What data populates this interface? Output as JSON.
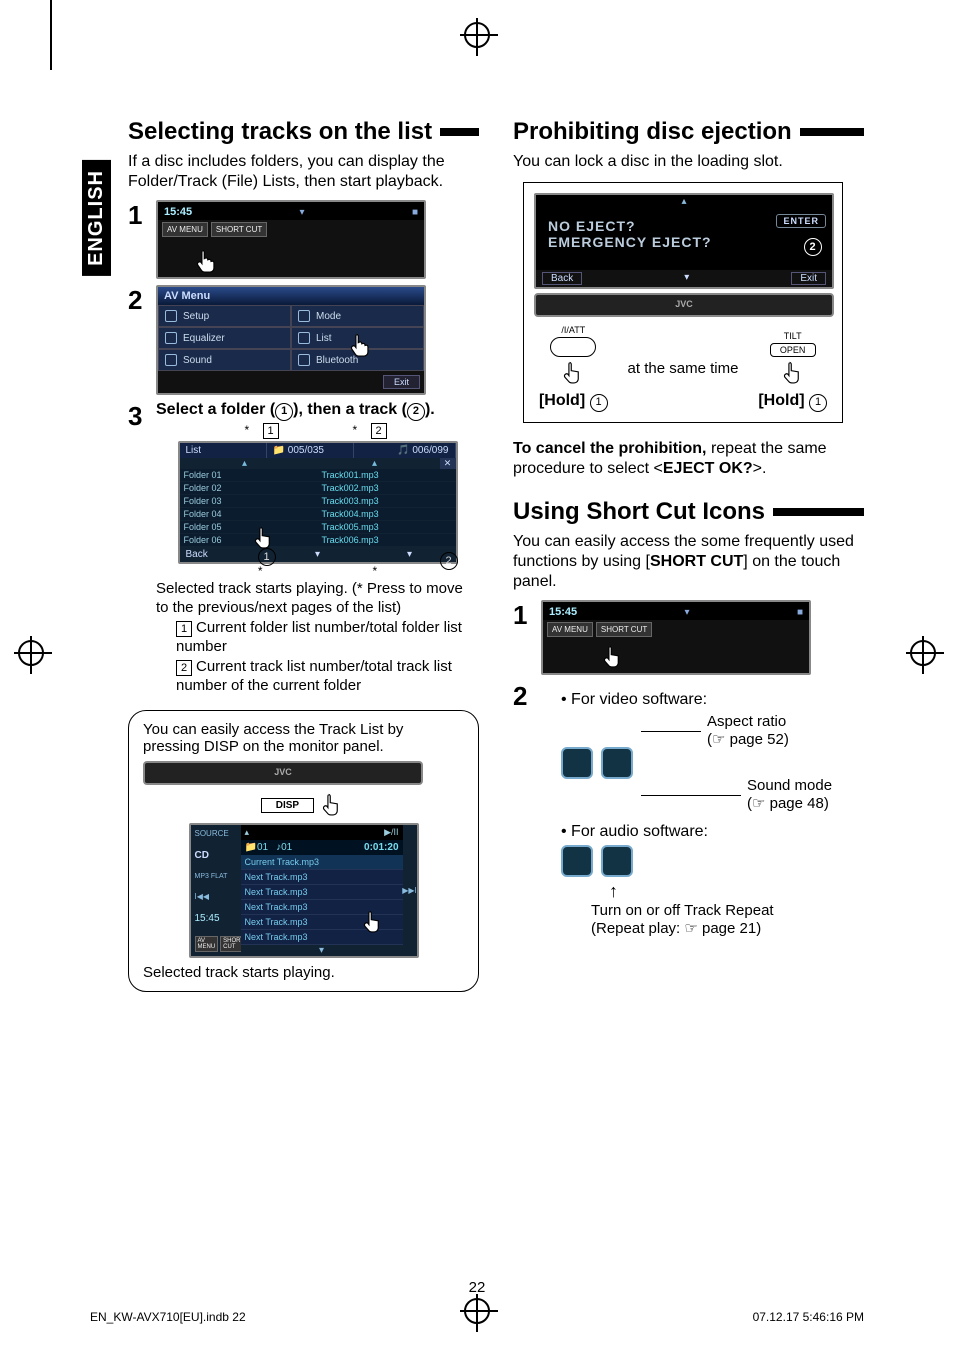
{
  "page": {
    "language_tab": "ENGLISH",
    "page_number": "22",
    "footer_left": "EN_KW-AVX710[EU].indb   22",
    "footer_right": "07.12.17   5:46:16 PM"
  },
  "left": {
    "heading": "Selecting tracks on the list",
    "intro": "If a disc includes folders, you can display the Folder/Track (File) Lists, then start playback.",
    "step1": {
      "num": "1",
      "time": "15:45",
      "btn1": "AV MENU",
      "btn2": "SHORT CUT"
    },
    "step2": {
      "num": "2",
      "title": "AV Menu",
      "items": [
        "Setup",
        "Equalizer",
        "Sound",
        "Mode",
        "List",
        "Bluetooth"
      ],
      "exit": "Exit"
    },
    "step3": {
      "num": "3",
      "text_a": "Select a folder (",
      "text_b": "), then a track (",
      "text_c": ").",
      "c1": "1",
      "c2": "2",
      "list_label": "List",
      "folder_counter": "005/035",
      "track_counter": "006/099",
      "sq1": "1",
      "sq2": "2",
      "folders": [
        "Folder 01",
        "Folder 02",
        "Folder 03",
        "Folder 04",
        "Folder 05",
        "Folder 06"
      ],
      "tracks": [
        "Track001.mp3",
        "Track002.mp3",
        "Track003.mp3",
        "Track004.mp3",
        "Track005.mp3",
        "Track006.mp3"
      ],
      "back": "Back",
      "caption1": "Selected track starts playing. (* Press to move to the previous/next pages of the list)",
      "li1": "Current folder list number/total folder list number",
      "li2": "Current track list number/total track list number of the current folder"
    },
    "tipbox": {
      "text": "You can easily access the Track List by pressing DISP on the monitor panel.",
      "jvc": "JVC",
      "disp": "DISP",
      "source": "SOURCE",
      "cd": "CD",
      "folder_num": "01",
      "track_num": "01",
      "elapsed": "0:01:20",
      "mp3": "MP3 FLAT",
      "tracks": [
        "Current Track.mp3",
        "Next Track.mp3",
        "Next Track.mp3",
        "Next Track.mp3",
        "Next Track.mp3",
        "Next Track.mp3"
      ],
      "time": "15:45",
      "btn1": "AV MENU",
      "btn2": "SHORT CUT",
      "caption": "Selected track starts playing."
    }
  },
  "right": {
    "heading1": "Prohibiting disc ejection",
    "intro1": "You can lock a disc in the loading slot.",
    "eject": {
      "line1": "NO EJECT?",
      "line2": "EMERGENCY EJECT?",
      "enter": "ENTER",
      "back": "Back",
      "exit": "Exit",
      "c2": "2"
    },
    "face": {
      "jvc": "JVC"
    },
    "hold": {
      "att": "  /I/ATT",
      "tilt": "TILT",
      "open": "OPEN",
      "same": "at the same time",
      "hold": "[Hold]",
      "c1": "1"
    },
    "cancel_a": "To cancel the prohibition, ",
    "cancel_b": "repeat the same procedure to select <",
    "cancel_c": "EJECT OK?",
    "cancel_d": ">.",
    "heading2": "Using Short Cut Icons",
    "intro2_a": "You can easily access the some frequently used functions by using [",
    "intro2_b": "SHORT CUT",
    "intro2_c": "] on the touch panel.",
    "sc_step1": {
      "num": "1",
      "time": "15:45",
      "btn1": "AV MENU",
      "btn2": "SHORT CUT"
    },
    "sc_step2": {
      "num": "2",
      "video_label": "For video software:",
      "aspect_a": "Aspect ratio",
      "aspect_b": "(☞ page 52)",
      "sound_a": "Sound mode",
      "sound_b": "(☞ page 48)",
      "audio_label": "For audio software:",
      "repeat_a": "Turn on or off Track Repeat",
      "repeat_b": "(Repeat play: ☞ page 21)"
    }
  }
}
